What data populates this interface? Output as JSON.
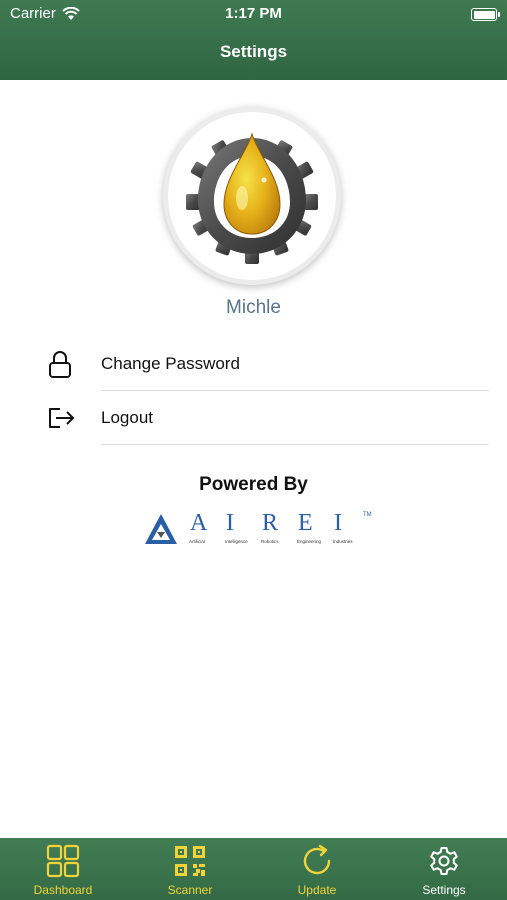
{
  "status_bar": {
    "carrier": "Carrier",
    "time": "1:17 PM"
  },
  "nav": {
    "title": "Settings"
  },
  "profile": {
    "name": "Michle"
  },
  "menu": [
    {
      "label": "Change Password",
      "icon": "lock-icon"
    },
    {
      "label": "Logout",
      "icon": "logout-icon"
    }
  ],
  "footer": {
    "powered_by": "Powered By",
    "brand_letters": [
      "A",
      "I",
      "R",
      "E",
      "I"
    ],
    "brand_tm": "TM",
    "brand_words": [
      "Artificial",
      "Intelligence",
      "Robotics",
      "Engineering",
      "Industries"
    ]
  },
  "tabs": [
    {
      "label": "Dashboard",
      "icon": "grid-icon",
      "active": false
    },
    {
      "label": "Scanner",
      "icon": "qr-code-icon",
      "active": false
    },
    {
      "label": "Update",
      "icon": "refresh-icon",
      "active": false
    },
    {
      "label": "Settings",
      "icon": "gear-icon",
      "active": true
    }
  ],
  "colors": {
    "bar_green": "#336a45",
    "tab_inactive": "#f2d33a",
    "tab_active": "#ffffff",
    "name_color": "#5a7488",
    "brand_blue": "#2a5fa6"
  }
}
